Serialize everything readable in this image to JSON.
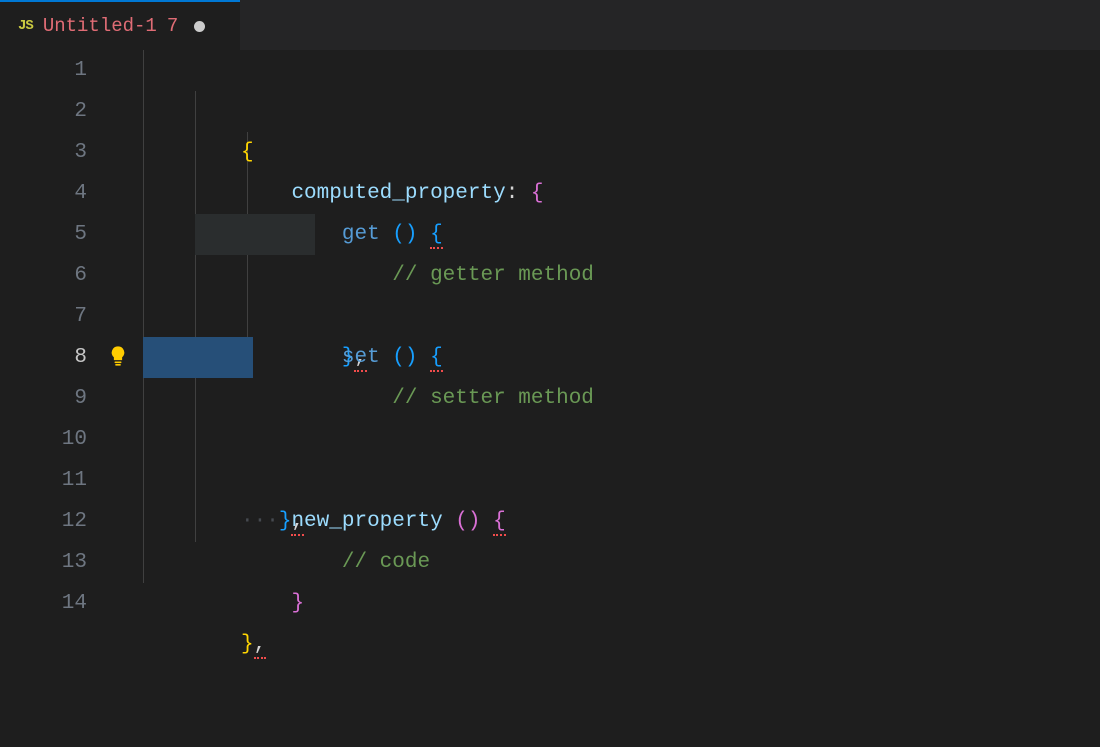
{
  "tab": {
    "lang_icon": "JS",
    "title": "Untitled-1",
    "problem_count": "7",
    "dirty": true
  },
  "colors": {
    "accent": "#0078d4",
    "comment": "#6a9955",
    "keyword": "#569cd6",
    "property": "#9cdcfe",
    "brace_yellow": "#ffd602",
    "brace_pink": "#da70d6",
    "brace_blue": "#179fff",
    "error": "#f14c4c"
  },
  "active_line": 8,
  "lines": {
    "1": {
      "brace": "{"
    },
    "2": {
      "prop": "computed_property",
      "colon": ":",
      "brace": "{"
    },
    "3": {
      "kw": "get",
      "paren": "()",
      "brace": "{"
    },
    "4": {
      "comment": "// getter method"
    },
    "5": {
      "brace": "}",
      "comma": ","
    },
    "6": {
      "kw": "set",
      "paren": "()",
      "brace": "{"
    },
    "7": {
      "comment": "// setter method"
    },
    "8": {
      "ws": "···",
      "brace": "}",
      "comma": ","
    },
    "9": {},
    "10": {
      "prop": "new_property",
      "paren": "()",
      "brace": "{"
    },
    "11": {
      "comment": "// code"
    },
    "12": {
      "brace": "}"
    },
    "13": {
      "brace": "}",
      "comma": ","
    },
    "14": {}
  },
  "line_numbers": [
    "1",
    "2",
    "3",
    "4",
    "5",
    "6",
    "7",
    "8",
    "9",
    "10",
    "11",
    "12",
    "13",
    "14"
  ]
}
